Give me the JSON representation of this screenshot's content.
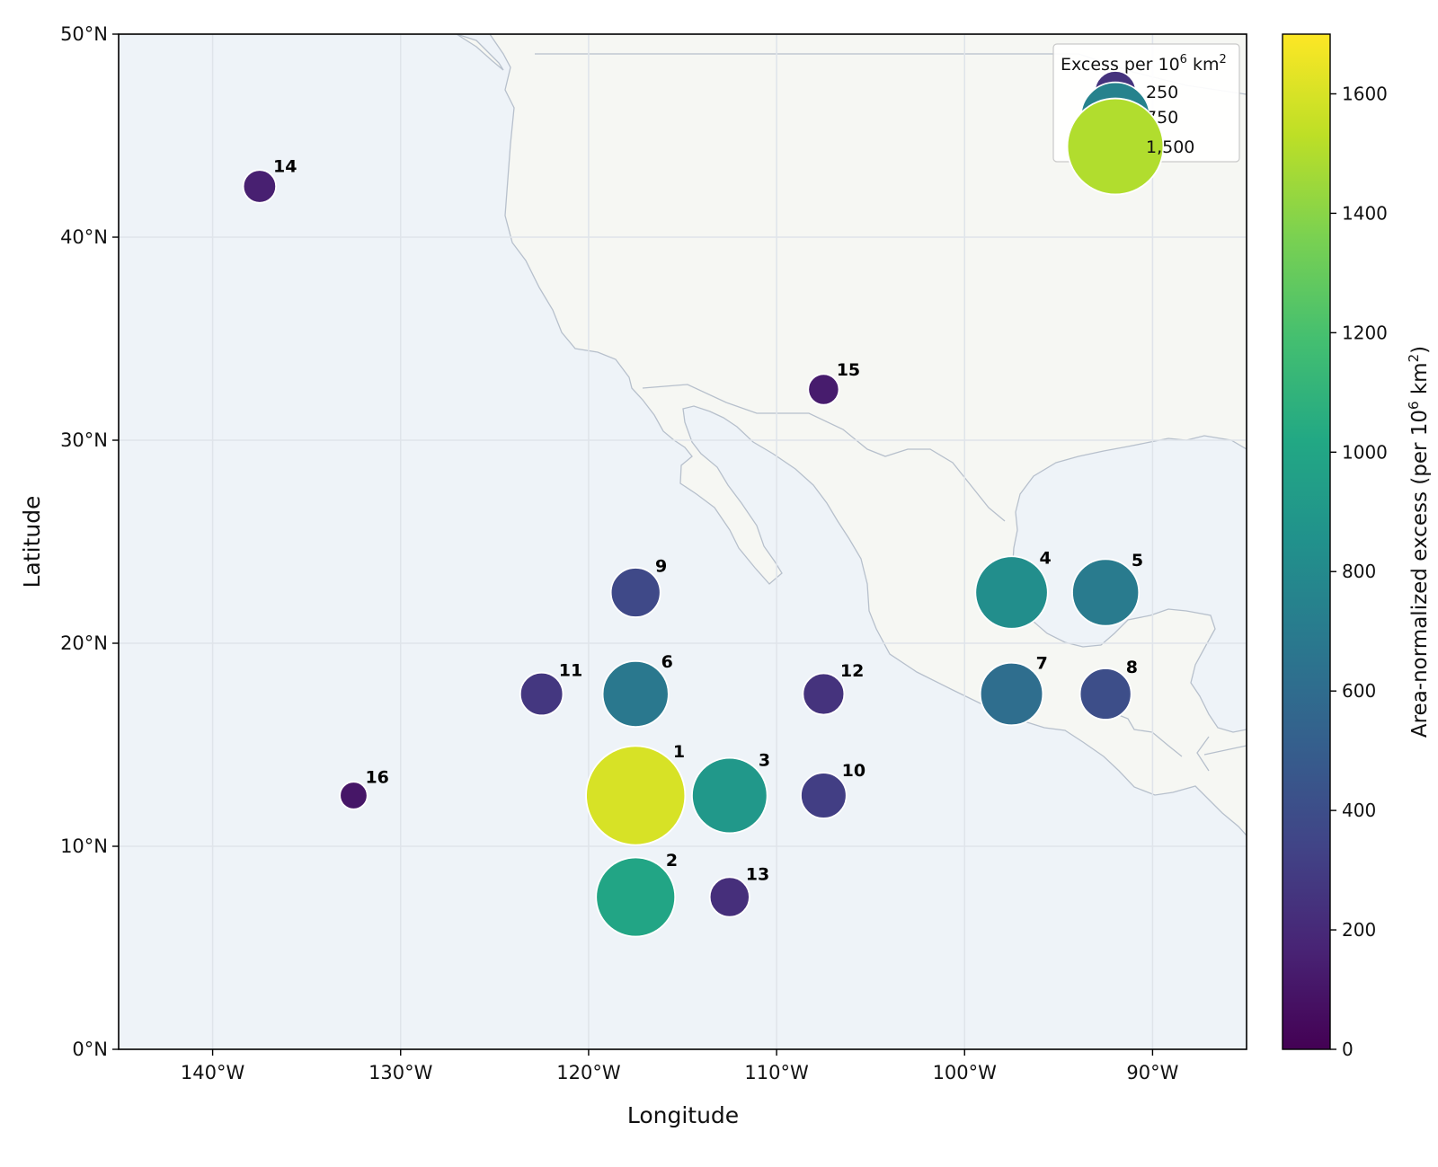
{
  "chart_data": {
    "type": "scatter",
    "xlabel": "Longitude",
    "ylabel": "Latitude",
    "xlim": [
      -145,
      -85
    ],
    "ylim": [
      0,
      50
    ],
    "x_ticks": [
      {
        "value": -140,
        "label": "140°W"
      },
      {
        "value": -130,
        "label": "130°W"
      },
      {
        "value": -120,
        "label": "120°W"
      },
      {
        "value": -110,
        "label": "110°W"
      },
      {
        "value": -100,
        "label": "100°W"
      },
      {
        "value": -90,
        "label": "90°W"
      }
    ],
    "y_ticks": [
      {
        "value": 0,
        "label": "0°N"
      },
      {
        "value": 10,
        "label": "10°N"
      },
      {
        "value": 20,
        "label": "20°N"
      },
      {
        "value": 30,
        "label": "30°N"
      },
      {
        "value": 40,
        "label": "40°N"
      },
      {
        "value": 50,
        "label": "50°N"
      }
    ],
    "grid": true,
    "colorscale": "viridis",
    "points": [
      {
        "label": "1",
        "lon": -117.5,
        "lat": 12.5,
        "value": 1600
      },
      {
        "label": "2",
        "lon": -117.5,
        "lat": 7.5,
        "value": 1000
      },
      {
        "label": "3",
        "lon": -112.5,
        "lat": 12.5,
        "value": 900
      },
      {
        "label": "4",
        "lon": -97.5,
        "lat": 22.5,
        "value": 830
      },
      {
        "label": "5",
        "lon": -92.5,
        "lat": 22.5,
        "value": 700
      },
      {
        "label": "6",
        "lon": -117.5,
        "lat": 17.5,
        "value": 680
      },
      {
        "label": "7",
        "lon": -97.5,
        "lat": 17.5,
        "value": 610
      },
      {
        "label": "8",
        "lon": -92.5,
        "lat": 17.5,
        "value": 400
      },
      {
        "label": "9",
        "lon": -117.5,
        "lat": 22.5,
        "value": 370
      },
      {
        "label": "10",
        "lon": -107.5,
        "lat": 12.5,
        "value": 310
      },
      {
        "label": "11",
        "lon": -122.5,
        "lat": 17.5,
        "value": 270
      },
      {
        "label": "12",
        "lon": -107.5,
        "lat": 17.5,
        "value": 250
      },
      {
        "label": "13",
        "lon": -112.5,
        "lat": 7.5,
        "value": 230
      },
      {
        "label": "14",
        "lon": -137.5,
        "lat": 42.5,
        "value": 150
      },
      {
        "label": "15",
        "lon": -107.5,
        "lat": 32.5,
        "value": 130
      },
      {
        "label": "16",
        "lon": -132.5,
        "lat": 12.5,
        "value": 100
      }
    ],
    "size_legend": {
      "title": "Excess per 10",
      "title_sup": "6",
      "title_unit": "km",
      "title_unit_sup": "2",
      "position": "top-right",
      "entries": [
        {
          "value": 250,
          "label": "250"
        },
        {
          "value": 750,
          "label": "750"
        },
        {
          "value": 1500,
          "label": "1,500"
        }
      ]
    },
    "colorbar": {
      "label_prefix": "Area-normalized excess (per 10",
      "label_sup": "6",
      "label_mid": " km",
      "label_sup2": "2",
      "label_suffix": ")",
      "range": [
        0,
        1700
      ],
      "ticks": [
        0,
        200,
        400,
        600,
        800,
        1000,
        1200,
        1400,
        1600
      ]
    },
    "colors": {
      "ocean": "#eef3f8",
      "land": "#f6f7f3",
      "coast": "#b7c0cc",
      "grid": "#dfe4ea",
      "point_edge": "#ffffff"
    }
  }
}
